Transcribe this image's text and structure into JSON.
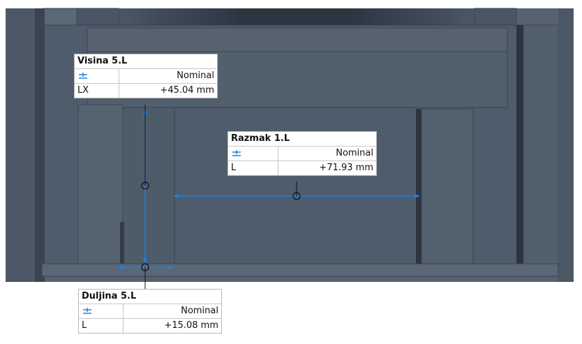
{
  "colors": {
    "model_face": "#4f5c6b",
    "model_dark": "#3a4552",
    "dimension_line": "#1f7fe0",
    "background": "#ffffff"
  },
  "annotations": {
    "visina": {
      "title": "Visina 5.L",
      "tolerance_icon": "symmetric-tolerance-icon",
      "tolerance": "Nominal",
      "param": "LX",
      "value": "+45.04 mm"
    },
    "razmak": {
      "title": "Razmak 1.L",
      "tolerance_icon": "symmetric-tolerance-icon",
      "tolerance": "Nominal",
      "param": "L",
      "value": "+71.93 mm"
    },
    "duljina": {
      "title": "Duljina 5.L",
      "tolerance_icon": "symmetric-tolerance-icon",
      "tolerance": "Nominal",
      "param": "L",
      "value": "+15.08 mm"
    }
  }
}
